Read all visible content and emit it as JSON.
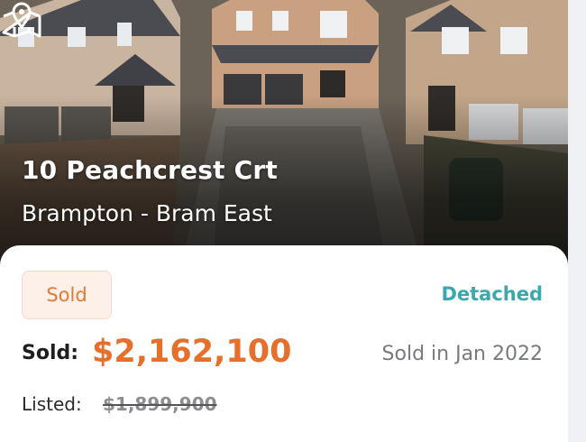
{
  "listing": {
    "address": "10 Peachcrest Crt",
    "area": "Brampton - Bram East",
    "status_badge": "Sold",
    "property_type": "Detached",
    "sold_label": "Sold:",
    "sold_price": "$2,162,100",
    "sold_date": "Sold in Jan 2022",
    "listed_label": "Listed:",
    "listed_price": "$1,899,900"
  },
  "icons": {
    "map": "map-pin-icon"
  },
  "colors": {
    "sold_price": "#e66f2c",
    "badge_text": "#e67a35",
    "badge_bg": "#fdf0e8",
    "property_type": "#3aa8ad",
    "secondary_text": "#777a7e"
  }
}
